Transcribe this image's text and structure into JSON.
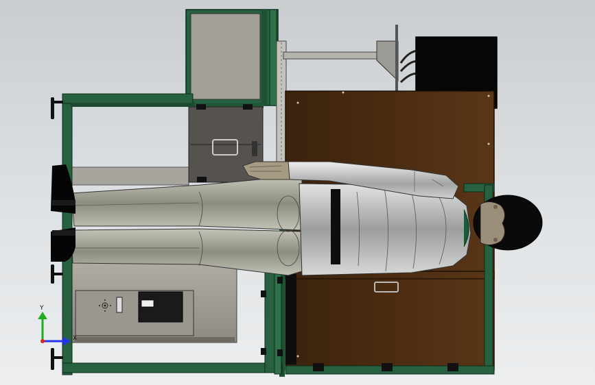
{
  "triad": {
    "y_label": "Y",
    "x_label": "X",
    "y_color": "#22aa22",
    "x_color": "#2233ee",
    "z_color": "#dd2222"
  },
  "colors": {
    "frame": "#27613f",
    "frame_dark": "#143d26",
    "wood": "#4a2c12",
    "wood_light": "#6b4520",
    "mannequin": "#8e8e82",
    "mannequin_light": "#b9b9ad",
    "suit": "#a9abab",
    "suit_light": "#d5d7d7",
    "monitor": "#060606",
    "sheet_metal": "#a19e98",
    "sheet_metal_dark": "#7a776f"
  }
}
